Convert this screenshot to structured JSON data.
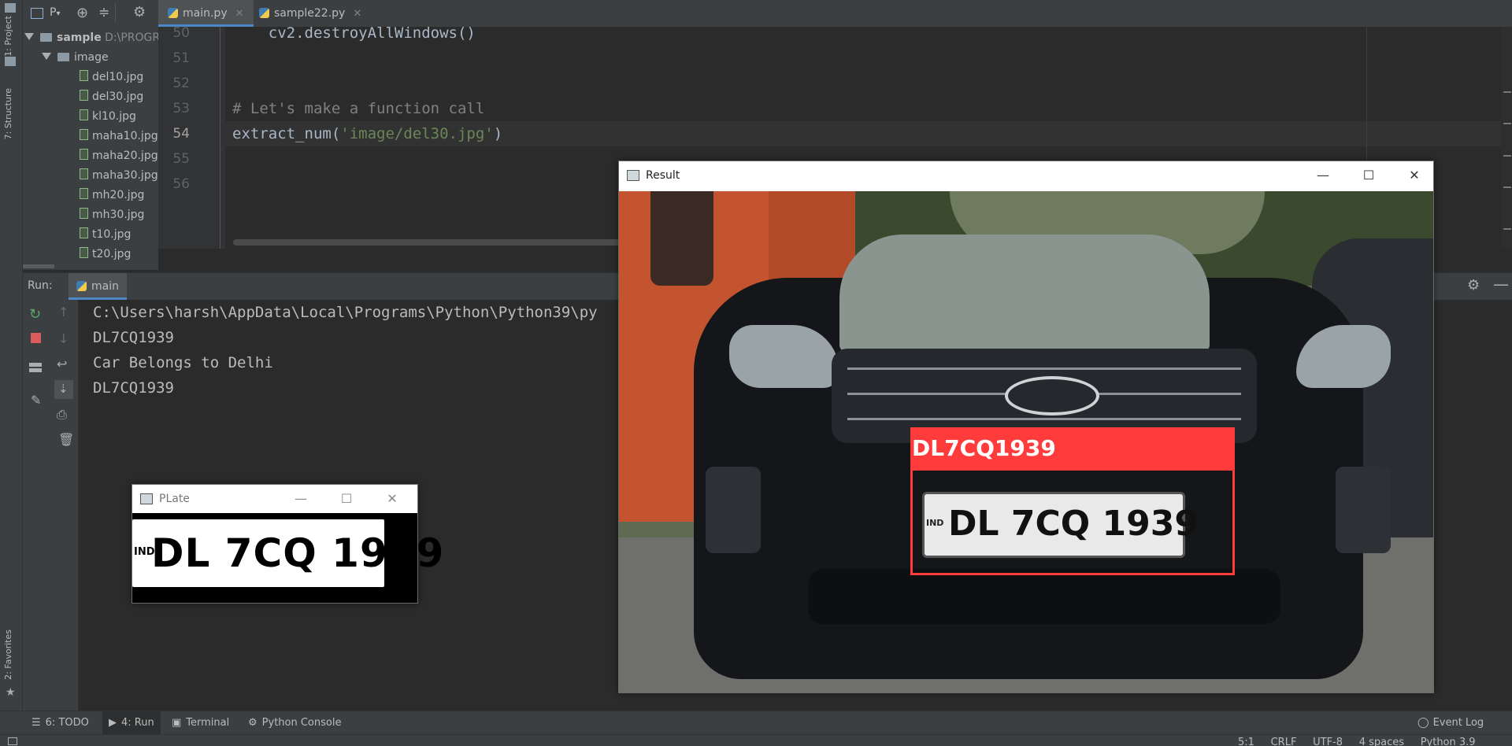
{
  "toolbar": {
    "project_dropdown": "P"
  },
  "left_strip": {
    "project_tab": "1: Project",
    "structure_tab": "7: Structure",
    "favorites_tab": "2: Favorites"
  },
  "project_tree": {
    "root_label": "sample",
    "root_path": "D:\\PROGR",
    "folder": "image",
    "files": [
      "del10.jpg",
      "del30.jpg",
      "kl10.jpg",
      "maha10.jpg",
      "maha20.jpg",
      "maha30.jpg",
      "mh20.jpg",
      "mh30.jpg",
      "t10.jpg",
      "t20.jpg"
    ]
  },
  "tabs": [
    {
      "label": "main.py",
      "active": true
    },
    {
      "label": "sample22.py",
      "active": false
    }
  ],
  "editor": {
    "line_numbers": [
      "50",
      "51",
      "52",
      "53",
      "54",
      "55",
      "56"
    ],
    "lines": {
      "l50": "    cv2.destroyAllWindows()",
      "l53": "# Let's make a function call",
      "l54_fn": "extract_num(",
      "l54_str": "'image/del30.jpg'",
      "l54_end": ")"
    }
  },
  "run": {
    "label": "Run:",
    "config": "main",
    "output": [
      "C:\\Users\\harsh\\AppData\\Local\\Programs\\Python\\Python39\\py",
      "DL7CQ1939",
      "Car Belongs to Delhi",
      "DL7CQ1939"
    ]
  },
  "bottom_tabs": {
    "todo": "6: TODO",
    "run": "4: Run",
    "terminal": "Terminal",
    "python_console": "Python Console",
    "event_log": "Event Log"
  },
  "status_bar": {
    "position": "5:1",
    "line_sep": "CRLF",
    "encoding": "UTF-8",
    "indent": "4 spaces",
    "interpreter": "Python 3.9"
  },
  "plate_window": {
    "title": "PLate",
    "plate_text": "DL 7CQ 1939",
    "ind_text": "IND"
  },
  "result_window": {
    "title": "Result",
    "detected_label": "DL7CQ1939",
    "plate_text": "DL 7CQ 1939",
    "ind_text": "IND"
  },
  "colors": {
    "accent_blue": "#4a88c7",
    "detection_red": "#ff3b3b",
    "ide_bg": "#2b2b2b"
  }
}
